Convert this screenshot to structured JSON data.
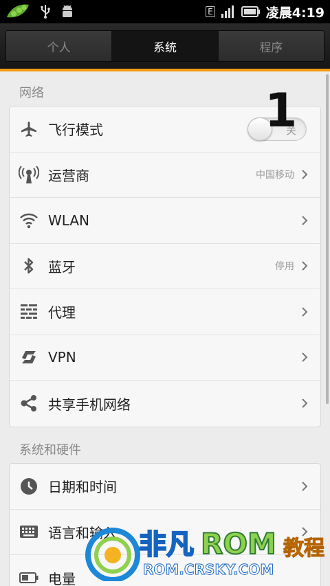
{
  "status_bar": {
    "network_label": "E",
    "clock": "凌晨4:19"
  },
  "tabs": [
    {
      "label": "个人",
      "active": false
    },
    {
      "label": "系统",
      "active": true
    },
    {
      "label": "程序",
      "active": false
    }
  ],
  "accent_color": "#f59a14",
  "sections": {
    "network": {
      "title": "网络",
      "items": [
        {
          "label": "飞行模式",
          "icon": "airplane-icon",
          "toggle_label": "关",
          "toggle_on": false
        },
        {
          "label": "运营商",
          "icon": "carrier-icon",
          "value": "中国移动"
        },
        {
          "label": "WLAN",
          "icon": "wifi-icon"
        },
        {
          "label": "蓝牙",
          "icon": "bluetooth-icon",
          "value": "停用"
        },
        {
          "label": "代理",
          "icon": "proxy-icon"
        },
        {
          "label": "VPN",
          "icon": "vpn-icon"
        },
        {
          "label": "共享手机网络",
          "icon": "share-icon"
        }
      ]
    },
    "system": {
      "title": "系统和硬件",
      "items": [
        {
          "label": "日期和时间",
          "icon": "clock-icon"
        },
        {
          "label": "语言和输入",
          "icon": "keyboard-icon"
        },
        {
          "label": "电量",
          "icon": "battery-icon"
        }
      ]
    }
  },
  "annotation_number": "1",
  "watermark": {
    "brand": "非凡ROM",
    "extra": "教程",
    "url": "ROM.CRSKY.COM"
  }
}
